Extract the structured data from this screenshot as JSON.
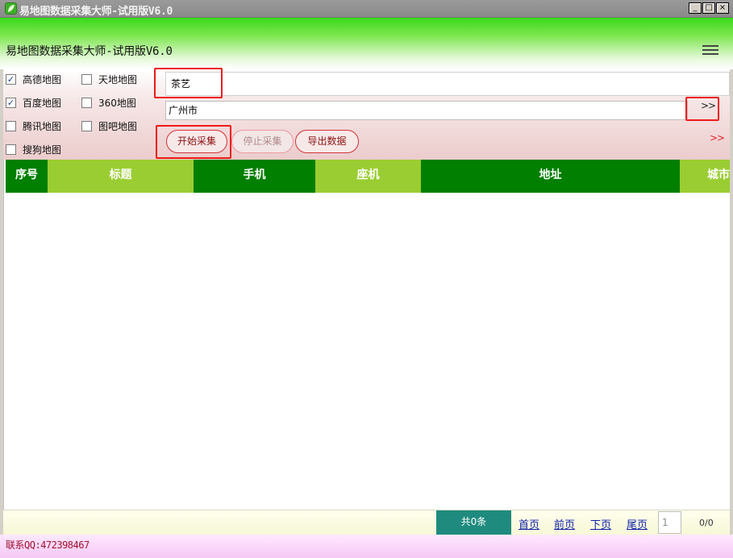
{
  "window": {
    "title": "易地图数据采集大师-试用版V6.0"
  },
  "header": {
    "title": "易地图数据采集大师-试用版V6.0"
  },
  "sources": [
    {
      "label": "高德地图",
      "checked": true
    },
    {
      "label": "天地地图",
      "checked": false
    },
    {
      "label": "百度地图",
      "checked": true
    },
    {
      "label": "360地图",
      "checked": false
    },
    {
      "label": "腾讯地图",
      "checked": false
    },
    {
      "label": "图吧地图",
      "checked": false
    },
    {
      "label": "搜狗地图",
      "checked": false
    }
  ],
  "search": {
    "keyword": "茶艺",
    "city": "广州市",
    "expand_label": ">>",
    "collapse_label": ">>"
  },
  "actions": {
    "start": "开始采集",
    "stop": "停止采集",
    "export": "导出数据"
  },
  "table": {
    "columns": [
      "序号",
      "标题",
      "手机",
      "座机",
      "地址",
      "城市"
    ]
  },
  "pagination": {
    "total": "共0条",
    "first": "首页",
    "prev": "前页",
    "next": "下页",
    "last": "尾页",
    "page": "1",
    "count": "0/0"
  },
  "status": {
    "contact": "联系QQ:472398467"
  },
  "colors": {
    "header_dark": "#007f00",
    "header_light": "#9acd32",
    "accent_red": "#ee1b1b",
    "total_bg": "#1f8b7f"
  }
}
